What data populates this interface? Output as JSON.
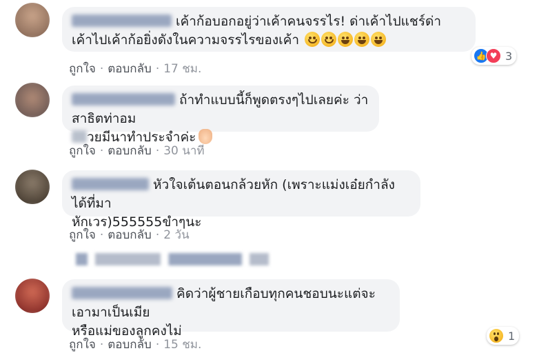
{
  "comments": [
    {
      "text": "เค้าก้อบอกอยู่ว่าเค้าคนจรรไร! ด่าเค้าไปแชร์ด่าเค้าไปเค้าก้อยิ่งดังในความจรรไรของเค้า",
      "line1": "เค้าก้อบอกอยู่ว่าเค้าคนจรรไร! ด่าเค้าไปแชร์ด่า",
      "line2": "เค้าไปเค้าก้อยิ่งดังในความจรรไรของเค้า",
      "like": "ถูกใจ",
      "reply": "ตอบกลับ",
      "time": "17 ชม.",
      "reaction_count": "3"
    },
    {
      "line1": "ถ้าทำแบบนี้ก็พูดตรงๆไปเลยค่ะ ว่าสาธิตท่าอม",
      "line2": "วยมีนาทำประจำค่ะ",
      "like": "ถูกใจ",
      "reply": "ตอบกลับ",
      "time": "30 นาที"
    },
    {
      "line1": "หัวใจเต้นตอนกล้วยหัก (เพราะแม่งเอ๋ยกำลังได้ที่มา",
      "line2": "หักเวร)555555ขำๆนะ",
      "like": "ถูกใจ",
      "reply": "ตอบกลับ",
      "time": "2 วัน"
    },
    {
      "line1": "คิดว่าผู้ชายเกือบทุกคนชอบนะแต่จะเอามาเป็นเมีย",
      "line2": "หรือแม่ของลูกคงไม่",
      "like": "ถูกใจ",
      "reply": "ตอบกลับ",
      "time": "15 ชม.",
      "reaction_count": "1"
    }
  ],
  "icons": {
    "like": "like-reaction-icon",
    "love": "love-reaction-icon",
    "wow": "wow-reaction-icon",
    "emoji": "smile-emoji-icon",
    "hand": "pointing-hand-emoji-icon"
  },
  "colors": {
    "bubble": "#f2f3f5",
    "meta": "#90949c",
    "like_blue": "#1877f2",
    "love_red": "#f33e58"
  }
}
